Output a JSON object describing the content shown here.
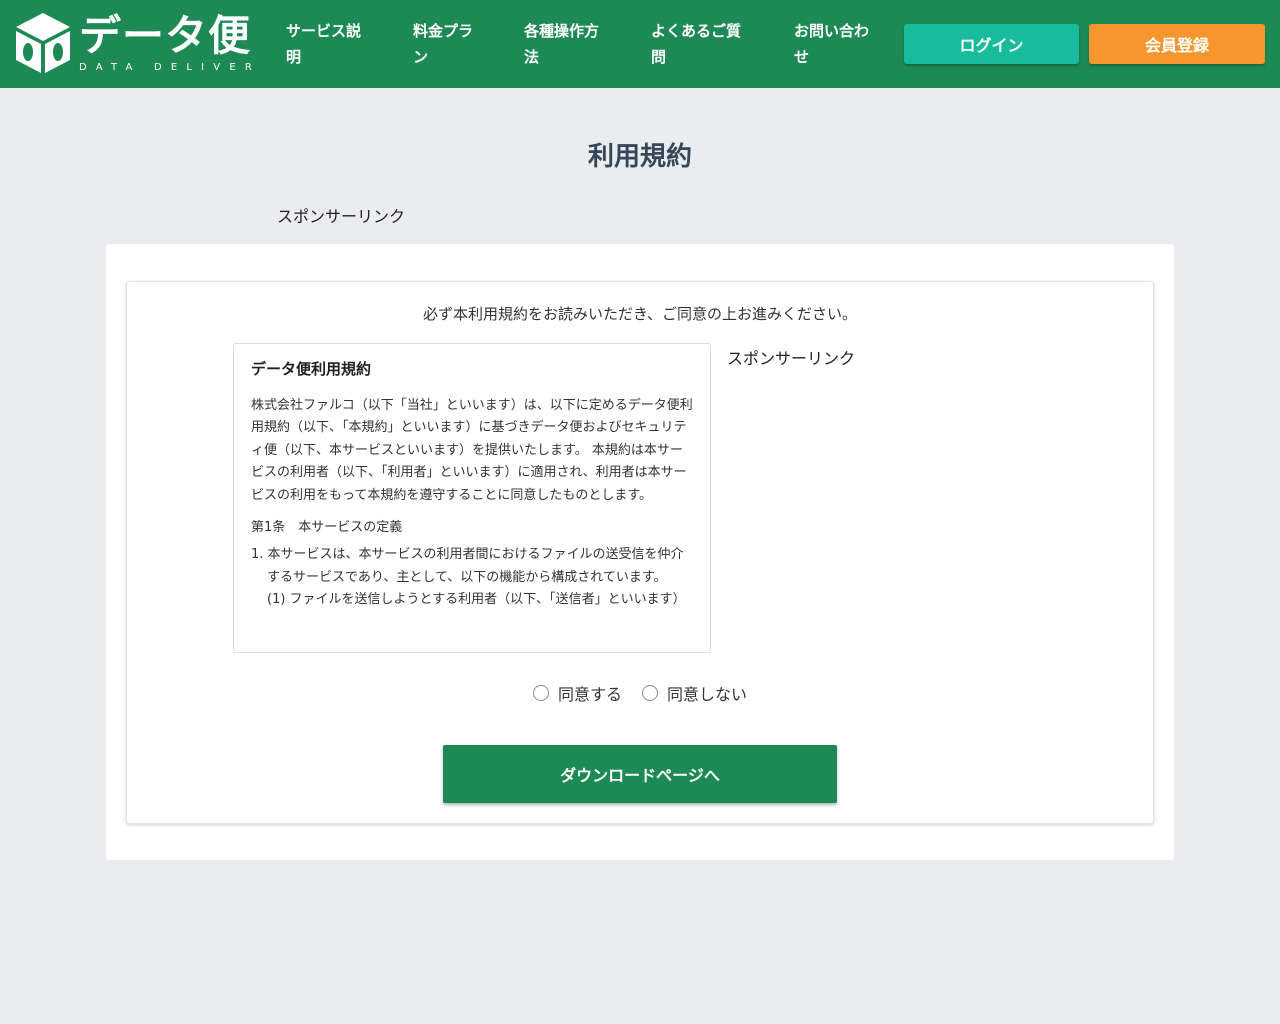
{
  "header": {
    "logo_text": "データ便",
    "logo_sub": "DATA DELIVER",
    "nav": [
      {
        "line1": "サービス説",
        "line2": "明"
      },
      {
        "line1": "料金プラ",
        "line2": "ン"
      },
      {
        "line1": "各種操作方",
        "line2": "法"
      },
      {
        "line1": "よくあるご質",
        "line2": "問"
      },
      {
        "line1": "お問い合わ",
        "line2": "せ"
      }
    ],
    "login_label": "ログイン",
    "register_label": "会員登録",
    "colors": {
      "header_bg": "#1d8a56",
      "login_bg": "#18bc9c",
      "register_bg": "#f7962f"
    }
  },
  "main": {
    "page_title": "利用規約",
    "sponsor_label": "スポンサーリンク",
    "notice": "必ず本利用規約をお読みいただき、ご同意の上お進みください。",
    "terms": {
      "title": "データ便利用規約",
      "intro": "株式会社ファルコ（以下「当社」といいます）は、以下に定めるデータ便利用規約（以下、「本規約」といいます）に基づきデータ便およびセキュリティ便（以下、本サービスといいます）を提供いたします。 本規約は本サービスの利用者（以下、「利用者」といいます）に適用され、利用者は本サービスの利用をもって本規約を遵守することに同意したものとします。",
      "article1": "第1条　本サービスの定義",
      "item1": "1. 本サービスは、本サービスの利用者間におけるファイルの送受信を仲介するサービスであり、主として、以下の機能から構成されています。",
      "item1_sub1": "(1) ファイルを送信しようとする利用者（以下、「送信者」といいます）"
    },
    "agree_label": "同意する",
    "disagree_label": "同意しない",
    "download_button": "ダウンロードページへ"
  }
}
